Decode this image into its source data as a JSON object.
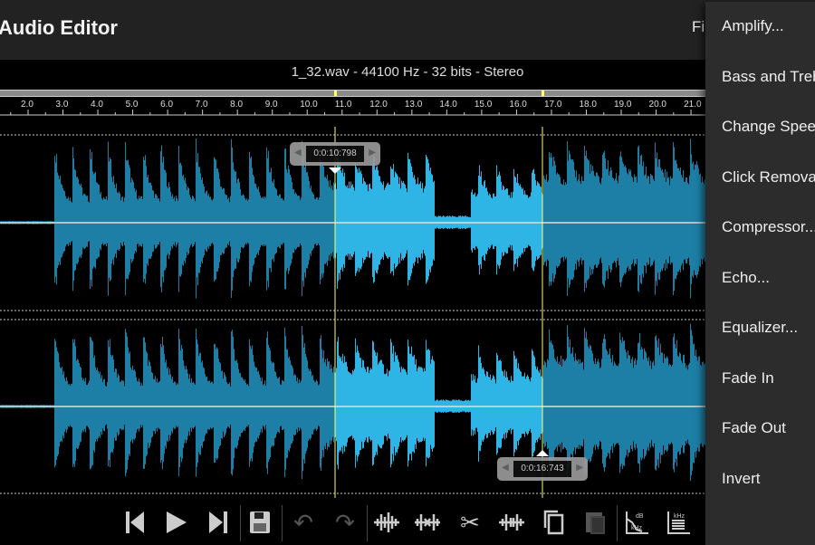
{
  "app": {
    "title": "Audio Editor",
    "file_menu": "Fi"
  },
  "file_info": "1_32.wav - 44100 Hz - 32 bits - Stereo",
  "ruler": {
    "ticks": [
      "2.0",
      "3.0",
      "4.0",
      "5.0",
      "6.0",
      "7.0",
      "8.0",
      "9.0",
      "10.0",
      "11.0",
      "12.0",
      "13.0",
      "14.0",
      "15.0",
      "16.0",
      "17.0",
      "18.0",
      "19.0",
      "20.0",
      "21.0"
    ]
  },
  "selection": {
    "start": "0:0:10:798",
    "end": "0:0:16:743"
  },
  "colors": {
    "waveform": "#1e7fa6",
    "selection": "#2fb4e6",
    "cursor": "#ffff66",
    "background": "#000000",
    "menu": "#2c2c2c"
  },
  "toolbar": [
    {
      "name": "skip-start",
      "icon": "⏮"
    },
    {
      "name": "play",
      "icon": "▶"
    },
    {
      "name": "skip-end",
      "icon": "⏭"
    },
    {
      "name": "save",
      "icon": "save"
    },
    {
      "name": "undo",
      "icon": "↶"
    },
    {
      "name": "redo",
      "icon": "↷"
    },
    {
      "name": "trim",
      "icon": "wave"
    },
    {
      "name": "delete-selection",
      "icon": "wave-x"
    },
    {
      "name": "cut",
      "icon": "✂"
    },
    {
      "name": "silence",
      "icon": "wave-gap"
    },
    {
      "name": "copy",
      "icon": "copy"
    },
    {
      "name": "paste",
      "icon": "paste"
    },
    {
      "name": "spectrum",
      "icon": "dB kHz"
    },
    {
      "name": "spectrogram",
      "icon": "kHz t"
    }
  ],
  "menu": {
    "items": [
      "Amplify...",
      "Bass and Treble...",
      "Change Speed...",
      "Click Removal...",
      "Compressor...",
      "Echo...",
      "Equalizer...",
      "Fade In",
      "Fade Out",
      "Invert"
    ]
  }
}
